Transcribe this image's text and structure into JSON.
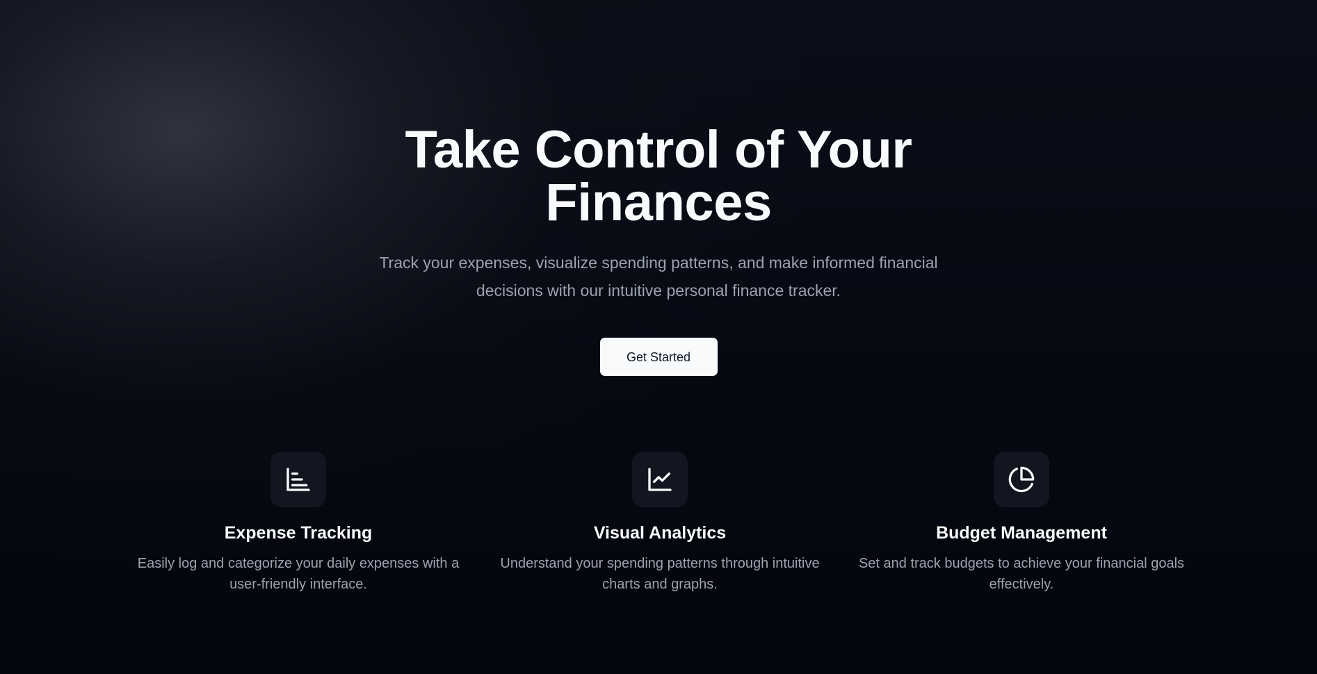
{
  "hero": {
    "title": "Take Control of Your Finances",
    "subtitle": "Track your expenses, visualize spending patterns, and make informed financial decisions with our intuitive personal finance tracker.",
    "cta_label": "Get Started"
  },
  "features": [
    {
      "icon": "bar-list-icon",
      "title": "Expense Tracking",
      "description": "Easily log and categorize your daily expenses with a user-friendly interface."
    },
    {
      "icon": "line-chart-icon",
      "title": "Visual Analytics",
      "description": "Understand your spending patterns through intuitive charts and graphs."
    },
    {
      "icon": "pie-chart-icon",
      "title": "Budget Management",
      "description": "Set and track budgets to achieve your financial goals effectively."
    }
  ],
  "colors": {
    "background": "#05070f",
    "text_primary": "#f8fafc",
    "text_muted": "#9ca3af",
    "button_bg": "#f8fafc",
    "button_text": "#0f172a",
    "icon_box_bg": "#111620"
  }
}
